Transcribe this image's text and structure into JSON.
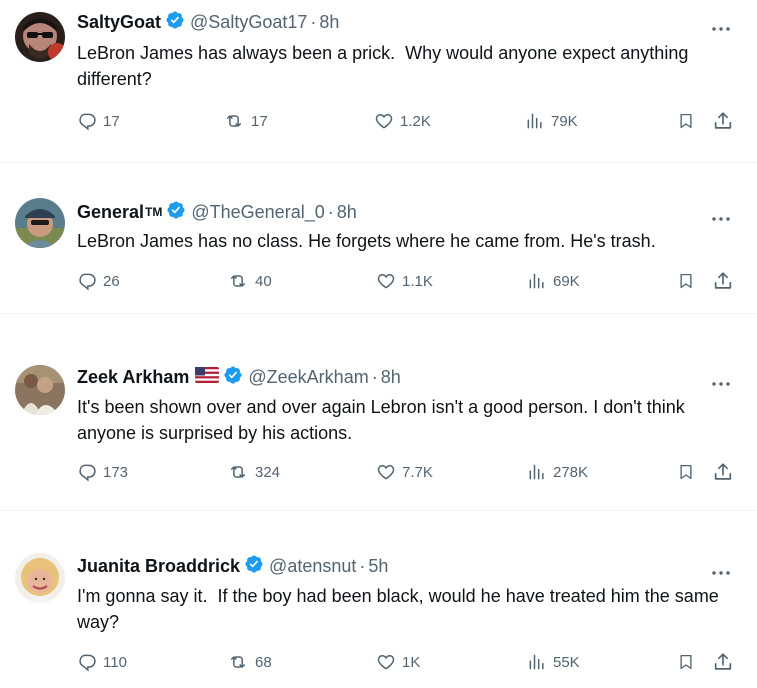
{
  "colors": {
    "verified": "#1d9bf0",
    "text": "#0f1419",
    "muted": "#536471",
    "divider": "#eff3f4"
  },
  "icons": {
    "reply": "reply-icon",
    "repost": "repost-icon",
    "like": "heart-icon",
    "views": "views-icon",
    "bookmark": "bookmark-icon",
    "share": "share-icon",
    "more": "more-icon",
    "verified": "verified-badge-icon"
  },
  "tweets": [
    {
      "name": "SaltyGoat",
      "handle": "@SaltyGoat17",
      "separator": "·",
      "time": "8h",
      "text": "LeBron James has always been a prick.  Why would anyone expect anything different?",
      "replies": "17",
      "reposts": "17",
      "likes": "1.2K",
      "views": "79K"
    },
    {
      "name": "General",
      "name_suffix": "TM",
      "handle": "@TheGeneral_0",
      "separator": "·",
      "time": "8h",
      "text": "LeBron James has no class. He forgets where he came from. He's trash.",
      "replies": "26",
      "reposts": "40",
      "likes": "1.1K",
      "views": "69K"
    },
    {
      "name": "Zeek Arkham",
      "handle": "@ZeekArkham",
      "separator": "·",
      "time": "8h",
      "text": "It's been shown over and over again Lebron isn't a good person. I don't think anyone is surprised by his actions.",
      "replies": "173",
      "reposts": "324",
      "likes": "7.7K",
      "views": "278K"
    },
    {
      "name": "Juanita Broaddrick",
      "handle": "@atensnut",
      "separator": "·",
      "time": "5h",
      "text": "I'm gonna say it.  If the boy had been black, would he have treated him the same way?",
      "replies": "110",
      "reposts": "68",
      "likes": "1K",
      "views": "55K"
    }
  ]
}
